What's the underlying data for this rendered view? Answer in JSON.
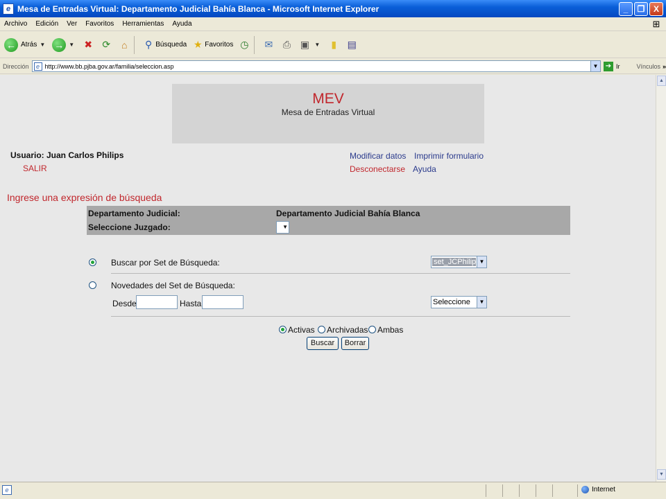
{
  "window": {
    "title": "Mesa de Entradas Virtual: Departamento Judicial Bahía Blanca - Microsoft Internet Explorer",
    "buttons": [
      "_",
      "❐",
      "X"
    ]
  },
  "menu": [
    "Archivo",
    "Edición",
    "Ver",
    "Favoritos",
    "Herramientas",
    "Ayuda"
  ],
  "toolbar": {
    "back": "Atrás",
    "search": "Búsqueda",
    "favorites": "Favoritos"
  },
  "address": {
    "label": "Dirección",
    "url": "http://www.bb.pjba.gov.ar/familia/seleccion.asp",
    "go": "Ir",
    "links": "Vínculos"
  },
  "page": {
    "banner_title": "MEV",
    "banner_subtitle": "Mesa de Entradas Virtual",
    "user": "Usuario: Juan Carlos Philips",
    "logout": "SALIR",
    "modify": "Modificar datos",
    "print": "Imprimir formulario",
    "disconnect": "Desconectarse",
    "help": "Ayuda",
    "heading": "Ingrese una expresión de búsqueda",
    "dept_label": "Departamento Judicial:",
    "dept_value": "Departamento Judicial Bahía Blanca",
    "court_label": "Seleccione Juzgado:",
    "search_set_label": "Buscar por Set de Búsqueda:",
    "search_set_value": "set_JCPhilips",
    "news_label": "Novedades del Set de Búsqueda:",
    "from_label": "Desde:",
    "to_label": "Hasta:",
    "news_select": "Seleccione",
    "opt_active": "Activas",
    "opt_archived": "Archivadas",
    "opt_both": "Ambas",
    "btn_search": "Buscar",
    "btn_clear": "Borrar"
  },
  "status": {
    "zone": "Internet"
  }
}
